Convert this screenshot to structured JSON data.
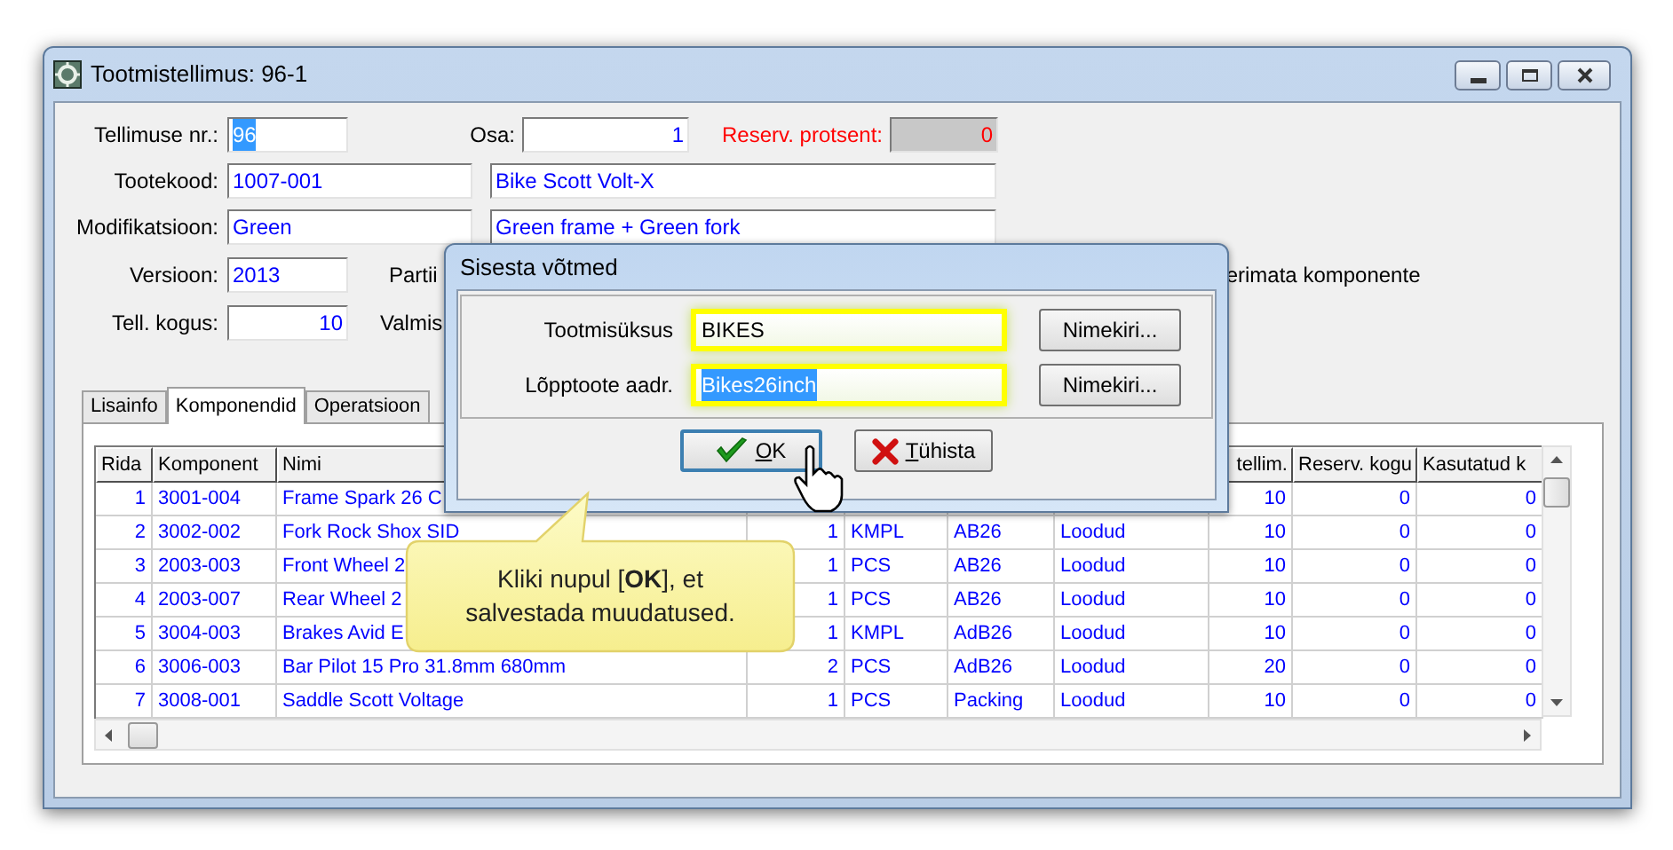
{
  "window": {
    "title": "Tootmistellimus: 96-1"
  },
  "form": {
    "order_no": {
      "label": "Tellimuse nr.:",
      "value": "96",
      "selected": true
    },
    "part": {
      "label": "Osa:",
      "value": "1"
    },
    "reserve_percent": {
      "label": "Reserv. protsent:",
      "value": "0",
      "disabled": true
    },
    "product_code": {
      "label": "Tootekood:",
      "value": "1007-001",
      "name": "Bike Scott Volt-X"
    },
    "modification": {
      "label": "Modifikatsioon:",
      "value": "Green",
      "name": "Green frame + Green fork"
    },
    "version": {
      "label": "Versioon:",
      "value": "2013"
    },
    "batch_label": "Partii",
    "quantity": {
      "label": "Tell. kogus:",
      "value": "10"
    },
    "finished_label": "Valmis",
    "checkbox_label": "erimata komponente"
  },
  "tabs": [
    {
      "label": "Lisainfo",
      "selected": false
    },
    {
      "label": "Komponendid",
      "selected": true
    },
    {
      "label": "Operatsioon",
      "selected": false
    }
  ],
  "table": {
    "columns": {
      "rida": "Rida",
      "komponent": "Komponent",
      "nimi": "Nimi",
      "tellim": "tellim.",
      "reserv_kogu": "Reserv. kogu",
      "kasutatud": "Kasutatud k"
    },
    "rows": [
      {
        "rida": "1",
        "komponent": "3001-004",
        "nimi": "Frame Spark 26 C",
        "tellim": "10",
        "reserv_kogu": "0",
        "kasutatud": "0"
      },
      {
        "rida": "2",
        "komponent": "3002-002",
        "nimi": "Fork Rock Shox SID",
        "column_4": "1",
        "column_5": "KMPL",
        "column_6": "AB26",
        "column_7": "Loodud",
        "tellim": "10",
        "reserv_kogu": "0",
        "kasutatud": "0"
      },
      {
        "rida": "3",
        "komponent": "2003-003",
        "nimi": "Front Wheel 2",
        "column_4": "1",
        "column_5": "PCS",
        "column_6": "AB26",
        "column_7": "Loodud",
        "tellim": "10",
        "reserv_kogu": "0",
        "kasutatud": "0"
      },
      {
        "rida": "4",
        "komponent": "2003-007",
        "nimi": "Rear Wheel 2",
        "column_4": "1",
        "column_5": "PCS",
        "column_6": "AB26",
        "column_7": "Loodud",
        "tellim": "10",
        "reserv_kogu": "0",
        "kasutatud": "0"
      },
      {
        "rida": "5",
        "komponent": "3004-003",
        "nimi": "Brakes Avid E",
        "column_4": "1",
        "column_5": "KMPL",
        "column_6": "AdB26",
        "column_7": "Loodud",
        "tellim": "10",
        "reserv_kogu": "0",
        "kasutatud": "0"
      },
      {
        "rida": "6",
        "komponent": "3006-003",
        "nimi": "Bar Pilot 15 Pro 31.8mm 680mm",
        "column_4": "2",
        "column_5": "PCS",
        "column_6": "AdB26",
        "column_7": "Loodud",
        "tellim": "20",
        "reserv_kogu": "0",
        "kasutatud": "0"
      },
      {
        "rida": "7",
        "komponent": "3008-001",
        "nimi": "Saddle Scott Voltage",
        "column_4": "1",
        "column_5": "PCS",
        "column_6": "Packing",
        "column_7": "Loodud",
        "tellim": "10",
        "reserv_kogu": "0",
        "kasutatud": "0"
      }
    ]
  },
  "dialog": {
    "title": "Sisesta võtmed",
    "fields": [
      {
        "label": "Tootmisüksus",
        "value": "BIKES",
        "selected": false,
        "highlighted": true,
        "button": "Nimekiri..."
      },
      {
        "label": "Lõpptoote aadr.",
        "value": "Bikes26inch",
        "selected": true,
        "highlighted": true,
        "button": "Nimekiri..."
      }
    ],
    "buttons": [
      {
        "kind": "ok",
        "label": "OK"
      },
      {
        "kind": "cancel",
        "label": "Tühista"
      }
    ]
  },
  "callout": {
    "text": "Kliki nupul [**OK**], et salvestada muudatused."
  }
}
